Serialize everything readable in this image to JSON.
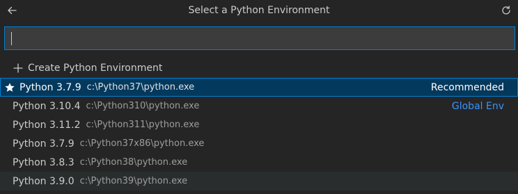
{
  "title": "Select a Python Environment",
  "search": {
    "value": "",
    "placeholder": ""
  },
  "create_item": {
    "label": "Create Python Environment",
    "icon": "plus-icon"
  },
  "environments": [
    {
      "name": "Python 3.7.9",
      "path": "c:\\Python37\\python.exe",
      "tag": "Recommended",
      "selected": true,
      "icon": "star-icon"
    },
    {
      "name": "Python 3.10.4",
      "path": "c:\\Python310\\python.exe",
      "tag": "Global Env",
      "selected": false
    },
    {
      "name": "Python 3.11.2",
      "path": "c:\\Python311\\python.exe",
      "tag": "",
      "selected": false
    },
    {
      "name": "Python 3.7.9",
      "path": "c:\\Python37x86\\python.exe",
      "tag": "",
      "selected": false
    },
    {
      "name": "Python 3.8.3",
      "path": "c:\\Python38\\python.exe",
      "tag": "",
      "selected": false
    },
    {
      "name": "Python 3.9.0",
      "path": "c:\\Python39\\python.exe",
      "tag": "",
      "selected": false
    }
  ],
  "colors": {
    "background": "#252526",
    "selection": "#04395e",
    "focus_border": "#007fd4",
    "link": "#3794ff"
  }
}
